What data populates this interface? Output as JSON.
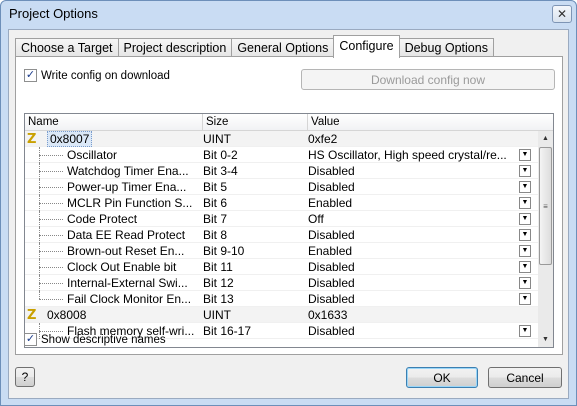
{
  "window": {
    "title": "Project Options"
  },
  "tabs": [
    {
      "label": "Choose a Target",
      "active": false
    },
    {
      "label": "Project description",
      "active": false
    },
    {
      "label": "General Options",
      "active": false
    },
    {
      "label": "Configure",
      "active": true
    },
    {
      "label": "Debug Options",
      "active": false
    }
  ],
  "configure": {
    "write_config_label": "Write config on download",
    "write_config_checked": true,
    "download_button": "Download config now",
    "show_names_label": "Show descriptive names",
    "show_names_checked": true
  },
  "grid": {
    "columns": [
      "Name",
      "Size",
      "Value"
    ],
    "groups": [
      {
        "name": "0x8007",
        "size": "UINT",
        "value": "0xfe2",
        "children": [
          {
            "name": "Oscillator",
            "size": "Bit 0-2",
            "value": "HS Oscillator, High speed crystal/re..."
          },
          {
            "name": "Watchdog Timer Ena...",
            "size": "Bit 3-4",
            "value": "Disabled"
          },
          {
            "name": "Power-up Timer Ena...",
            "size": "Bit 5",
            "value": "Disabled"
          },
          {
            "name": "MCLR Pin Function S...",
            "size": "Bit 6",
            "value": "Enabled"
          },
          {
            "name": "Code Protect",
            "size": "Bit 7",
            "value": "Off"
          },
          {
            "name": "Data EE Read Protect",
            "size": "Bit 8",
            "value": "Disabled"
          },
          {
            "name": "Brown-out Reset En...",
            "size": "Bit 9-10",
            "value": "Enabled"
          },
          {
            "name": "Clock Out Enable bit",
            "size": "Bit 11",
            "value": "Disabled"
          },
          {
            "name": "Internal-External Swi...",
            "size": "Bit 12",
            "value": "Disabled"
          },
          {
            "name": "Fail Clock Monitor En...",
            "size": "Bit 13",
            "value": "Disabled"
          }
        ]
      },
      {
        "name": "0x8008",
        "size": "UINT",
        "value": "0x1633",
        "children": [
          {
            "name": "Flash memory self-wri...",
            "size": "Bit 16-17",
            "value": "Disabled"
          }
        ]
      }
    ]
  },
  "footer": {
    "help_button": "?",
    "ok_button": "OK",
    "cancel_button": "Cancel"
  },
  "icons": {
    "close": "close-icon",
    "group": "z-register-icon",
    "dropdown": "chevron-down-icon"
  }
}
